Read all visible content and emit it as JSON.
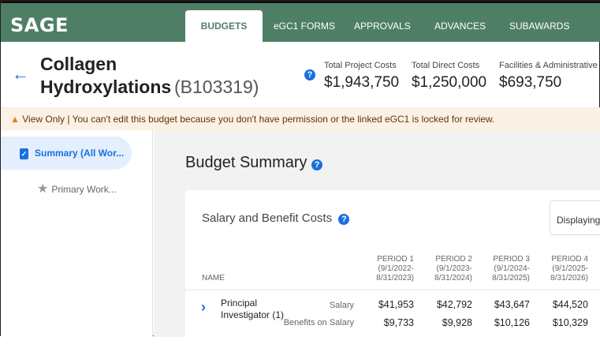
{
  "nav": {
    "logo": "SAGE",
    "tabs": [
      "BUDGETS",
      "eGC1 FORMS",
      "APPROVALS",
      "ADVANCES",
      "SUBAWARDS"
    ],
    "active": "BUDGETS"
  },
  "header": {
    "title": "Collagen Hydroxylations",
    "code": "(B103319)",
    "stats": [
      {
        "label": "Total Project Costs",
        "value": "$1,943,750"
      },
      {
        "label": "Total Direct Costs",
        "value": "$1,250,000"
      },
      {
        "label": "Facilities & Administrative",
        "value": "$693,750"
      }
    ]
  },
  "banner": {
    "text": "View Only | You can't edit this budget because you don't have permission or the linked eGC1 is locked for review."
  },
  "sidebar": {
    "items": [
      {
        "label": "Summary (All Wor...",
        "icon": "clipboard-check-icon"
      },
      {
        "label": "Primary Work...",
        "icon": "star-icon"
      }
    ]
  },
  "main": {
    "title": "Budget Summary",
    "card": {
      "title": "Salary and Benefit Costs",
      "display": "Displaying",
      "columns": {
        "name": "NAME",
        "periods": [
          {
            "p": "PERIOD 1",
            "a": "(9/1/2022-",
            "b": "8/31/2023)"
          },
          {
            "p": "PERIOD 2",
            "a": "(9/1/2023-",
            "b": "8/31/2024)"
          },
          {
            "p": "PERIOD 3",
            "a": "(9/1/2024-",
            "b": "8/31/2025)"
          },
          {
            "p": "PERIOD 4",
            "a": "(9/1/2025-",
            "b": "8/31/2026)"
          }
        ]
      },
      "rows": [
        {
          "name": "Principal Investigator (1)",
          "lines": [
            {
              "label": "Salary",
              "values": [
                "$41,953",
                "$42,792",
                "$43,647",
                "$44,520"
              ]
            },
            {
              "label": "Benefits on Salary",
              "values": [
                "$9,733",
                "$9,928",
                "$10,126",
                "$10,329"
              ]
            }
          ]
        }
      ]
    }
  },
  "colors": {
    "nav": "#4e7f66",
    "accent": "#1a6fe0",
    "banner": "#fbf1e4"
  }
}
